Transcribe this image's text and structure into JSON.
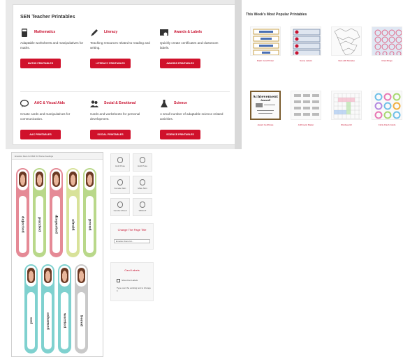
{
  "sen": {
    "title": "SEN Teacher Printables",
    "categories": [
      {
        "title": "Mathematics",
        "desc": "Adaptable worksheets and manipulatives for maths.",
        "button": "MATHS PRINTABLES",
        "icon": "calculator-icon"
      },
      {
        "title": "Literacy",
        "desc": "Teaching resources related to reading and writing.",
        "button": "LITERACY PRINTABLES",
        "icon": "pencil-icon"
      },
      {
        "title": "Awards & Labels",
        "desc": "Quickly create certificates and classroom labels.",
        "button": "AWARDS PRINTABLES",
        "icon": "certificate-icon"
      },
      {
        "title": "AAC & Visual Aids",
        "desc": "Create cards and manipulatives for communication.",
        "button": "AAC PRINTABLES",
        "icon": "speech-bubble-icon"
      },
      {
        "title": "Social & Emotional",
        "desc": "Cards and worksheets for personal development.",
        "button": "SOCIAL PRINTABLES",
        "icon": "people-icon"
      },
      {
        "title": "Science",
        "desc": "A small number of adaptable science related activities.",
        "button": "SCIENCE PRINTABLES",
        "icon": "flask-icon"
      }
    ]
  },
  "popular": {
    "title": "This Week's Most Popular Printables",
    "items": [
      {
        "caption": "Flash Card Printer",
        "icon": "flash-cards-icon"
      },
      {
        "caption": "Name Labels",
        "icon": "name-labels-icon"
      },
      {
        "caption": "Nets (3D Models)",
        "icon": "nets-icon"
      },
      {
        "caption": "Chart Bingo",
        "icon": "bingo-icon"
      },
      {
        "caption": "Award Certificate",
        "icon": "certificate-thumb-icon"
      },
      {
        "caption": "Arithmetic Maker",
        "icon": "arithmetic-icon"
      },
      {
        "caption": "Wordsearch",
        "icon": "wordsearch-icon"
      },
      {
        "caption": "Circle Flash Cards",
        "icon": "circle-cards-icon"
      }
    ]
  },
  "app": {
    "header": "Emotion Fans for Mild Or Worse Feelings",
    "cards_top": [
      {
        "word": "dejected",
        "color": "#e58a96"
      },
      {
        "word": "puzzled",
        "color": "#b9d88a"
      },
      {
        "word": "disgusted",
        "color": "#e58a96"
      },
      {
        "word": "afraid",
        "color": "#d8e29a"
      },
      {
        "word": "proud",
        "color": "#b9d88a"
      }
    ],
    "cards_bottom": [
      {
        "word": "sad",
        "color": "#7fd1cf"
      },
      {
        "word": "ashamed",
        "color": "#7fd1cf"
      },
      {
        "word": "worried",
        "color": "#7fd1cf"
      },
      {
        "word": "bored",
        "color": "#c9c9c9"
      }
    ],
    "symbol_buttons": [
      "Hold Pose",
      "Hold Pose",
      "Female Skin",
      "Male Skin",
      "Gender Mixed",
      "WIDGIT"
    ],
    "title_box": {
      "title": "Change The Page Title",
      "value": "Emotion Fans for..."
    },
    "labels_box": {
      "title": "Card Labels",
      "checkbox": "Show Fan Labels",
      "hint": "Type over the existing text to change it."
    }
  }
}
